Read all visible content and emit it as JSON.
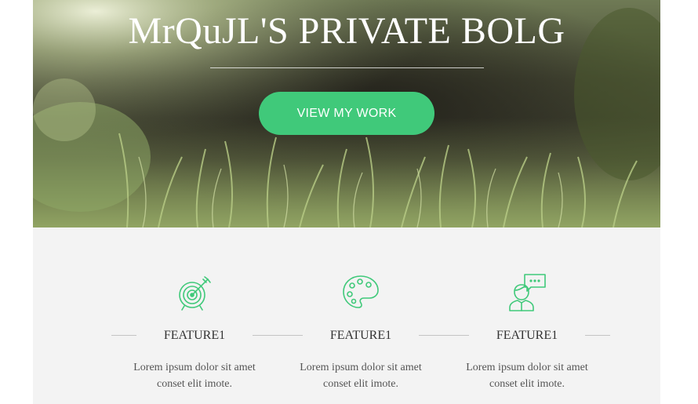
{
  "hero": {
    "title": "MrQuJL'S PRIVATE BOLG",
    "cta_label": "VIEW MY WORK"
  },
  "features": [
    {
      "icon": "target-icon",
      "title": "FEATURE1",
      "desc_line1": "Lorem ipsum dolor sit amet",
      "desc_line2": "conset elit imote."
    },
    {
      "icon": "palette-icon",
      "title": "FEATURE1",
      "desc_line1": "Lorem ipsum dolor sit amet",
      "desc_line2": "conset elit imote."
    },
    {
      "icon": "chat-user-icon",
      "title": "FEATURE1",
      "desc_line1": "Lorem ipsum dolor sit amet",
      "desc_line2": "conset elit imote."
    }
  ],
  "colors": {
    "accent": "#40c97a",
    "features_bg": "#f3f3f3",
    "text": "#333333"
  }
}
